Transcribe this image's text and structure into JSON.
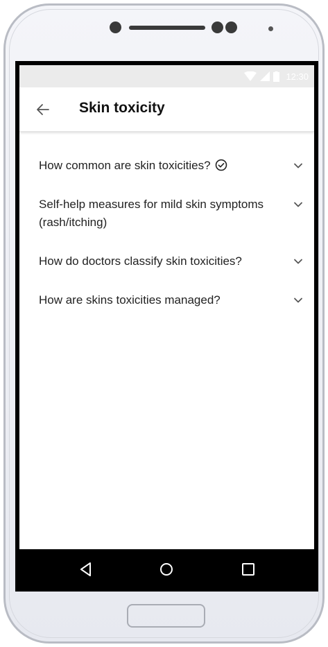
{
  "status_bar": {
    "time": "12:30",
    "icons": [
      "wifi-icon",
      "signal-icon",
      "battery-icon"
    ]
  },
  "toolbar": {
    "back_icon": "arrow-left-icon",
    "title": "Skin toxicity"
  },
  "faq": [
    {
      "question": "How common are skin toxicities?",
      "completed": true
    },
    {
      "question": "Self-help measures for mild skin symptoms (rash/itching)",
      "completed": false
    },
    {
      "question": "How do doctors classify skin toxicities?",
      "completed": false
    },
    {
      "question": "How are skins toxicities managed?",
      "completed": false
    }
  ],
  "nav_bar": {
    "back": "triangle-back-icon",
    "home": "circle-home-icon",
    "recents": "square-recents-icon"
  },
  "colors": {
    "status_bar": "#ebebeb",
    "text": "#222222",
    "icon": "#555555"
  }
}
